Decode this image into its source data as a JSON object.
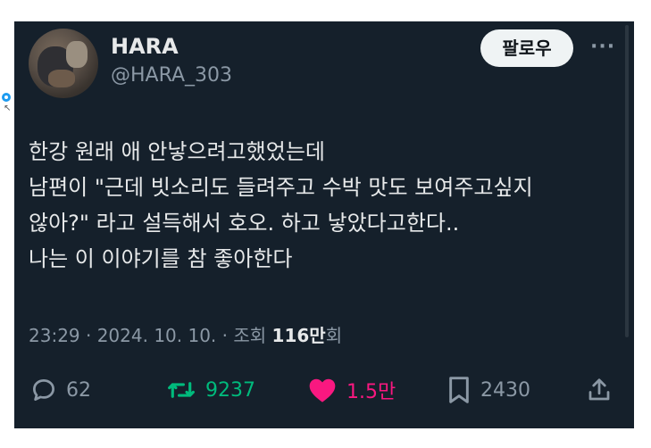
{
  "post": {
    "display_name": "HARA",
    "handle": "@HARA_303",
    "follow_label": "팔로우",
    "more_label": "···",
    "text_lines": [
      "한강 원래 애 안낳으려고했었는데",
      "남편이 \"근데 빗소리도 들려주고 수박 맛도 보여주고싶지",
      "않아?\" 라고 설득해서 호오. 하고 낳았다고한다..",
      "나는 이 이야기를 참 좋아한다"
    ],
    "meta": {
      "time": "23:29 · 2024. 10. 10. · 조회 ",
      "views": "116만",
      "views_suffix": "회"
    },
    "actions": {
      "replies": "62",
      "reposts": "9237",
      "likes": "1.5만",
      "bookmarks": "2430"
    }
  },
  "icons": {
    "reply": "reply-icon",
    "repost": "repost-icon",
    "like": "heart-icon",
    "bookmark": "bookmark-icon",
    "share": "share-icon",
    "more": "more-icon"
  },
  "colors": {
    "background": "#15202b",
    "text": "#e7e9ea",
    "muted": "#8b98a5",
    "repost": "#00ba7c",
    "like": "#f91880"
  }
}
